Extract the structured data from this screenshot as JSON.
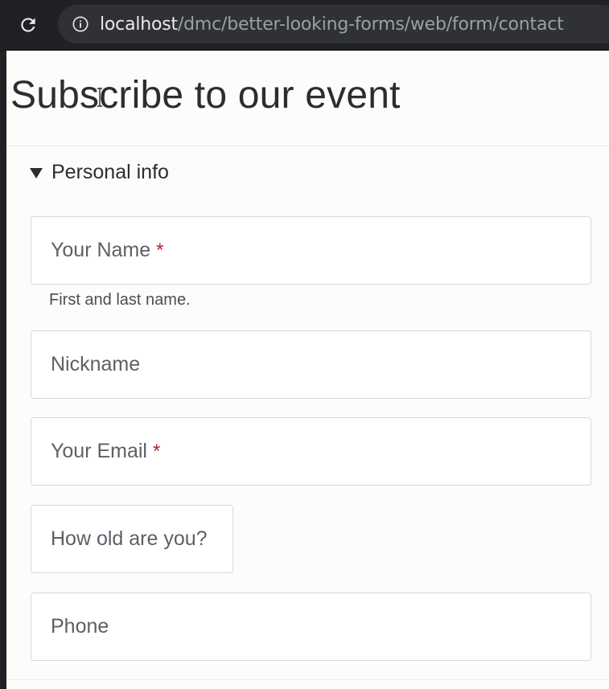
{
  "browser": {
    "url_host": "localhost",
    "url_path": "/dmc/better-looking-forms/web/form/contact",
    "reload_icon": "reload-icon",
    "info_icon": "info-icon"
  },
  "page": {
    "title": "Subscribe to our event"
  },
  "form": {
    "section_label": "Personal info",
    "section_icon": "triangle-down-icon",
    "fields": [
      {
        "label": "Your Name",
        "required_mark": "*",
        "help": "First and last name."
      },
      {
        "label": "Nickname"
      },
      {
        "label": "Your Email",
        "required_mark": "*"
      },
      {
        "label": "How old are you?"
      },
      {
        "label": "Phone"
      }
    ]
  },
  "colors": {
    "page_background": "#fcfcfa",
    "required_mark": "#b4232f",
    "field_border": "#d7d8da",
    "browser_toolbar": "#202124"
  }
}
